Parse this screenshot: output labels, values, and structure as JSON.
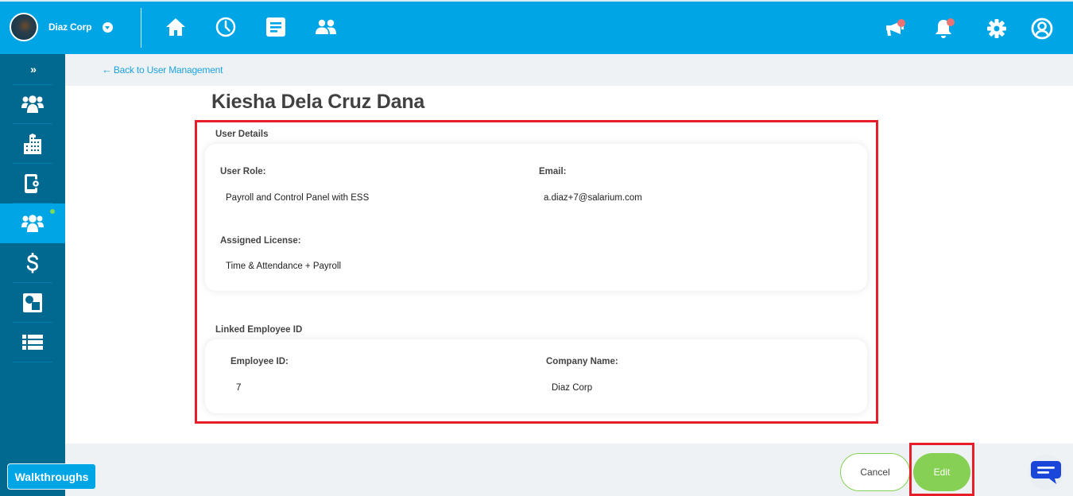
{
  "topbar": {
    "company_name": "Diaz Corp",
    "nav_icons": [
      "home-icon",
      "clock-icon",
      "document-icon",
      "people-icon"
    ],
    "right_icons": [
      "announcement-icon",
      "bell-icon",
      "gear-icon",
      "user-icon"
    ],
    "colors": {
      "bar": "#00a5e6",
      "badge": "#ec7373"
    }
  },
  "sidebar": {
    "toggle_label": "»",
    "items": [
      {
        "icon": "users-group-icon",
        "active": false
      },
      {
        "icon": "building-icon",
        "active": false
      },
      {
        "icon": "mobile-settings-icon",
        "active": false
      },
      {
        "icon": "users-group-icon",
        "active": true
      },
      {
        "icon": "dollar-icon",
        "active": false
      },
      {
        "icon": "shapes-icon",
        "active": false
      },
      {
        "icon": "list-icon",
        "active": false
      }
    ],
    "colors": {
      "bg": "#016890",
      "active": "#00a5e6",
      "online": "#7ed957"
    }
  },
  "back_link": {
    "label": "Back to User Management",
    "arrow": "←"
  },
  "page": {
    "title": "Kiesha Dela Cruz Dana"
  },
  "user_details": {
    "section_label": "User Details",
    "user_role_label": "User Role:",
    "user_role_value": "Payroll and Control Panel with ESS",
    "email_label": "Email:",
    "email_value": "a.diaz+7@salarium.com",
    "license_label": "Assigned License:",
    "license_value": "Time & Attendance + Payroll"
  },
  "linked_employee": {
    "section_label": "Linked Employee ID",
    "employee_id_label": "Employee ID:",
    "employee_id_value": "7",
    "company_name_label": "Company Name:",
    "company_name_value": "Diaz Corp"
  },
  "footer": {
    "cancel_label": "Cancel",
    "edit_label": "Edit",
    "walkthroughs_label": "Walkthroughs",
    "colors": {
      "accent_green": "#86d154",
      "highlight_red": "#e61e2a"
    }
  }
}
